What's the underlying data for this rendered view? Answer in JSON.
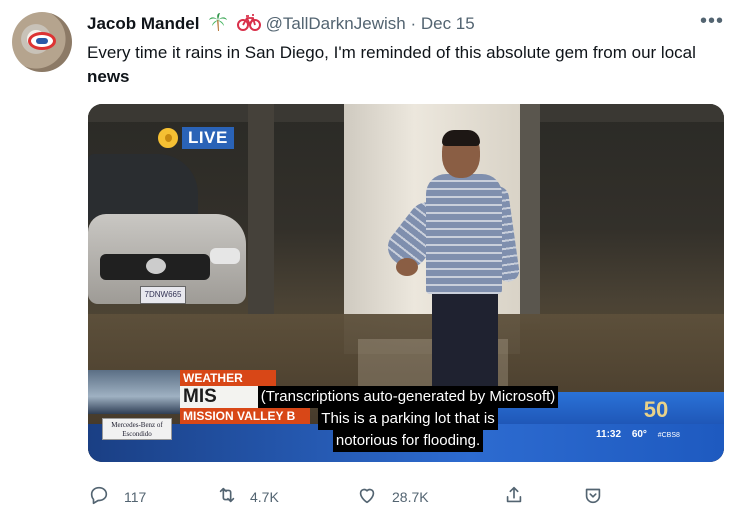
{
  "tweet": {
    "author_name": "Jacob Mandel",
    "author_emojis": [
      "palm-tree",
      "bicycle"
    ],
    "handle": "@TallDarknJewish",
    "separator": "·",
    "date": "Dec 15",
    "more_label": "•••",
    "text_before": "Every time it rains in San Diego, I'm reminded of this absolute gem from our local ",
    "text_bold": "news"
  },
  "media": {
    "live_label": "LIVE",
    "plate_text": "7DNW665",
    "weather_alert": "WEATHER ALERT",
    "headline": "MIS",
    "subheadline": "MISSION VALLEY B",
    "sponsor_text": "Mercedes-Benz of Escondido",
    "superbowl_mark": "50",
    "ticker_time": "11:32",
    "ticker_temp": "60°",
    "ticker_handle": "#CBS8",
    "caption_line1": "(Transcriptions auto-generated by Microsoft)",
    "caption_line2": "This is a parking lot that is",
    "caption_line3": "notorious for flooding."
  },
  "actions": {
    "reply_count": "117",
    "retweet_count": "4.7K",
    "like_count": "28.7K"
  },
  "icons": {
    "reply": "reply-icon",
    "retweet": "retweet-icon",
    "like": "heart-icon",
    "share": "share-icon",
    "extra": "chevron-icon"
  },
  "colors": {
    "text": "#0f1419",
    "muted": "#536471",
    "live_blue": "#2a63b7",
    "alert_orange": "#d84717"
  }
}
